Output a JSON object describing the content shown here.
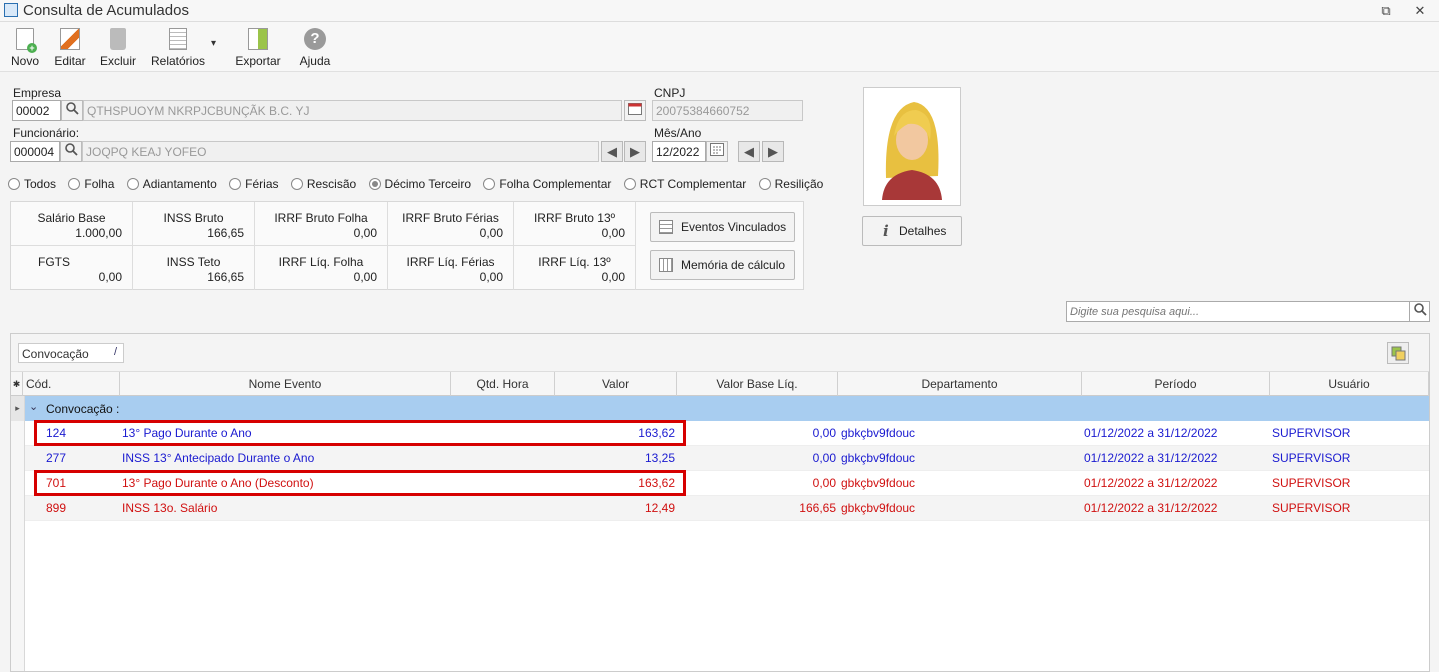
{
  "window": {
    "title": "Consulta de Acumulados",
    "restore_glyph": "⧉",
    "close_glyph": "✕"
  },
  "toolbar": {
    "items": [
      {
        "label": "Novo",
        "icon": "new-doc-icon"
      },
      {
        "label": "Editar",
        "icon": "edit-icon"
      },
      {
        "label": "Excluir",
        "icon": "trash-icon"
      },
      {
        "label": "Relatórios",
        "icon": "report-icon"
      },
      {
        "label": "Exportar",
        "icon": "export-icon"
      },
      {
        "label": "Ajuda",
        "icon": "help-icon"
      }
    ],
    "dropdown_glyph": "▾",
    "help_glyph": "?"
  },
  "form": {
    "empresa_label": "Empresa",
    "empresa_code": "00002",
    "empresa_name": "QTHSPUOYM NKRPJCBUNÇÃK B.C. YJ",
    "cnpj_label": "CNPJ",
    "cnpj_value": "20075384660752",
    "funcionario_label": "Funcionário:",
    "funcionario_code": "000004",
    "funcionario_name": "JOQPQ KEAJ YOFEO",
    "mesano_label": "Mês/Ano",
    "mesano_value": "12/2022",
    "arrow_left": "◀",
    "arrow_right": "▶"
  },
  "filters": [
    {
      "label": "Todos",
      "selected": false
    },
    {
      "label": "Folha",
      "selected": false
    },
    {
      "label": "Adiantamento",
      "selected": false
    },
    {
      "label": "Férias",
      "selected": false
    },
    {
      "label": "Rescisão",
      "selected": false
    },
    {
      "label": "Décimo Terceiro",
      "selected": true
    },
    {
      "label": "Folha Complementar",
      "selected": false
    },
    {
      "label": "RCT Complementar",
      "selected": false
    },
    {
      "label": "Resilição",
      "selected": false
    }
  ],
  "summary": {
    "row1": [
      {
        "label": "Salário Base",
        "value": "1.000,00"
      },
      {
        "label": "INSS Bruto",
        "value": "166,65"
      },
      {
        "label": "IRRF Bruto Folha",
        "value": "0,00"
      },
      {
        "label": "IRRF Bruto Férias",
        "value": "0,00"
      },
      {
        "label": "IRRF Bruto 13º",
        "value": "0,00"
      }
    ],
    "row2": [
      {
        "label": "FGTS",
        "value": "0,00"
      },
      {
        "label": "INSS Teto",
        "value": "166,65"
      },
      {
        "label": "IRRF Líq. Folha",
        "value": "0,00"
      },
      {
        "label": "IRRF Líq. Férias",
        "value": "0,00"
      },
      {
        "label": "IRRF Líq. 13º",
        "value": "0,00"
      }
    ],
    "eventos_button": "Eventos Vinculados",
    "memoria_button": "Memória de cálculo"
  },
  "profile": {
    "details_button": "Detalhes",
    "info_glyph": "i"
  },
  "search": {
    "placeholder": "Digite sua pesquisa aqui..."
  },
  "grid": {
    "group_by": "Convocação",
    "group_sort_glyph": "/",
    "columns": [
      "Cód.",
      "Nome Evento",
      "Qtd. Hora",
      "Valor",
      "Valor Base Líq.",
      "Departamento",
      "Período",
      "Usuário"
    ],
    "corner_glyph": "✱",
    "group_row_label": "Convocação :",
    "expand_glyph": "▸",
    "collapse_glyph": "⌄",
    "rows": [
      {
        "cod": "124",
        "evento": "13° Pago Durante o Ano",
        "qtd": "",
        "valor": "163,62",
        "base": "0,00",
        "depto": "gbkçbv9fdouc",
        "periodo": "01/12/2022 a 31/12/2022",
        "usuario": "SUPERVISOR",
        "color": "blue",
        "highlight": true
      },
      {
        "cod": "277",
        "evento": "INSS 13° Antecipado Durante o Ano",
        "qtd": "",
        "valor": "13,25",
        "base": "0,00",
        "depto": "gbkçbv9fdouc",
        "periodo": "01/12/2022 a 31/12/2022",
        "usuario": "SUPERVISOR",
        "color": "blue",
        "highlight": false
      },
      {
        "cod": "701",
        "evento": "13° Pago Durante o Ano (Desconto)",
        "qtd": "",
        "valor": "163,62",
        "base": "0,00",
        "depto": "gbkçbv9fdouc",
        "periodo": "01/12/2022 a 31/12/2022",
        "usuario": "SUPERVISOR",
        "color": "red",
        "highlight": true
      },
      {
        "cod": "899",
        "evento": "INSS 13o. Salário",
        "qtd": "",
        "valor": "12,49",
        "base": "166,65",
        "depto": "gbkçbv9fdouc",
        "periodo": "01/12/2022 a 31/12/2022",
        "usuario": "SUPERVISOR",
        "color": "red",
        "highlight": false
      }
    ]
  },
  "colors": {
    "blue_text": "#1a1ad0",
    "red_text": "#d01010",
    "group_row_bg": "#a8cdf0",
    "highlight_border": "#d60000"
  }
}
